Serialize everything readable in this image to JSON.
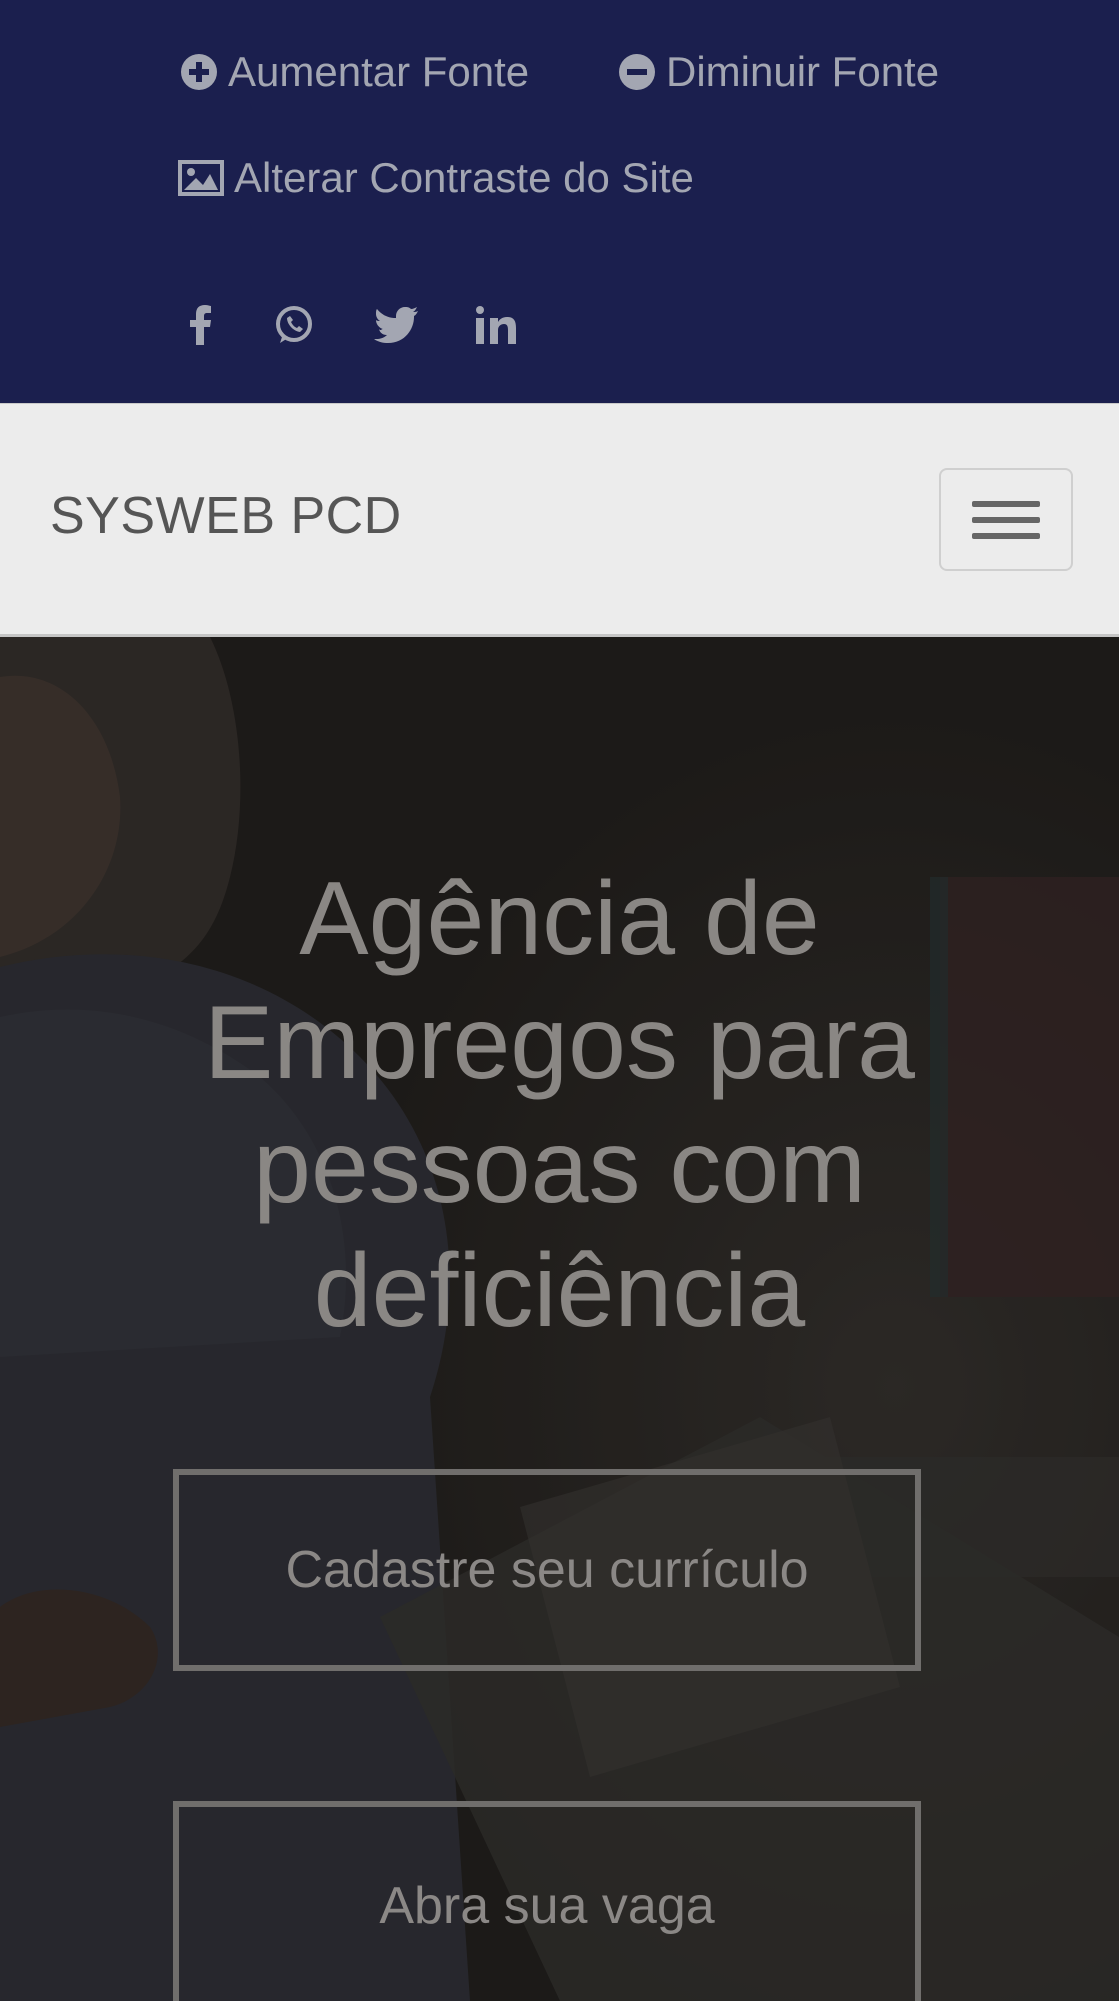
{
  "accessibility": {
    "increase_font": {
      "label": "Aumentar Fonte",
      "icon": "plus-circle-icon"
    },
    "decrease_font": {
      "label": "Diminuir Fonte",
      "icon": "minus-circle-icon"
    },
    "contrast": {
      "label": "Alterar Contraste do Site",
      "icon": "image-icon"
    },
    "social": [
      {
        "icon": "facebook-icon"
      },
      {
        "icon": "whatsapp-icon"
      },
      {
        "icon": "twitter-icon"
      },
      {
        "icon": "linkedin-icon"
      }
    ]
  },
  "navbar": {
    "brand": "SYSWEB PCD",
    "toggler_icon": "hamburger-menu-icon"
  },
  "hero": {
    "title": "Agência de Empregos para pessoas com deficiência",
    "primary_button": "Cadastre seu currículo",
    "secondary_button": "Abra sua vaga"
  },
  "colors": {
    "top_bar": "#1b1f4e",
    "navbar": "#ececec",
    "hero_text": "#8a8784"
  }
}
